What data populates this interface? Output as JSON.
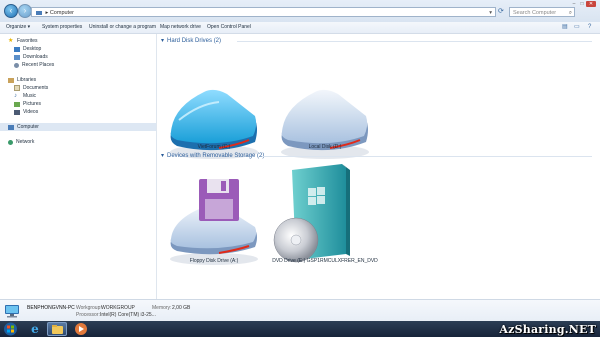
{
  "titlebar": {
    "address": "Computer",
    "search_placeholder": "Search Computer",
    "back_icon": "back-arrow-icon",
    "forward_icon": "forward-arrow-icon"
  },
  "toolbar": {
    "organize": "Organize ▾",
    "system_properties": "System properties",
    "uninstall": "Uninstall or change a program",
    "map_drive": "Map network drive",
    "control_panel": "Open Control Panel"
  },
  "sidebar": {
    "favorites": {
      "label": "Favorites",
      "items": [
        "Desktop",
        "Downloads",
        "Recent Places"
      ]
    },
    "libraries": {
      "label": "Libraries",
      "items": [
        "Documents",
        "Music",
        "Pictures",
        "Videos"
      ]
    },
    "computer": "Computer",
    "network": "Network"
  },
  "content": {
    "hdd_header": "Hard Disk Drives (2)",
    "removable_header": "Devices with Removable Storage (2)",
    "drives": [
      {
        "label": "VietForum (C:)",
        "icon": "hard-disk-icon"
      },
      {
        "label": "Local Disk (D:)",
        "icon": "hard-disk-icon"
      },
      {
        "label": "Floppy Disk Drive (A:)",
        "icon": "floppy-drive-icon"
      },
      {
        "label": "DVD Drive (E:) GSP1RMCULXFRER_EN_DVD",
        "icon": "dvd-drive-icon"
      }
    ]
  },
  "details": {
    "computer_name": "BENPHONGVNN-PC",
    "workgroup_label": "Workgroup:",
    "workgroup_value": "WORKGROUP",
    "memory_label": "Memory:",
    "memory_value": "2,00 GB",
    "processor_label": "Processor:",
    "processor_value": "Intel(R) Core(TM) i3-25..."
  },
  "watermark": "AzSharing.NET",
  "colors": {
    "accent": "#2b5d9a",
    "disk_top": "#35b4ea",
    "taskbar": "#1c2b42"
  }
}
